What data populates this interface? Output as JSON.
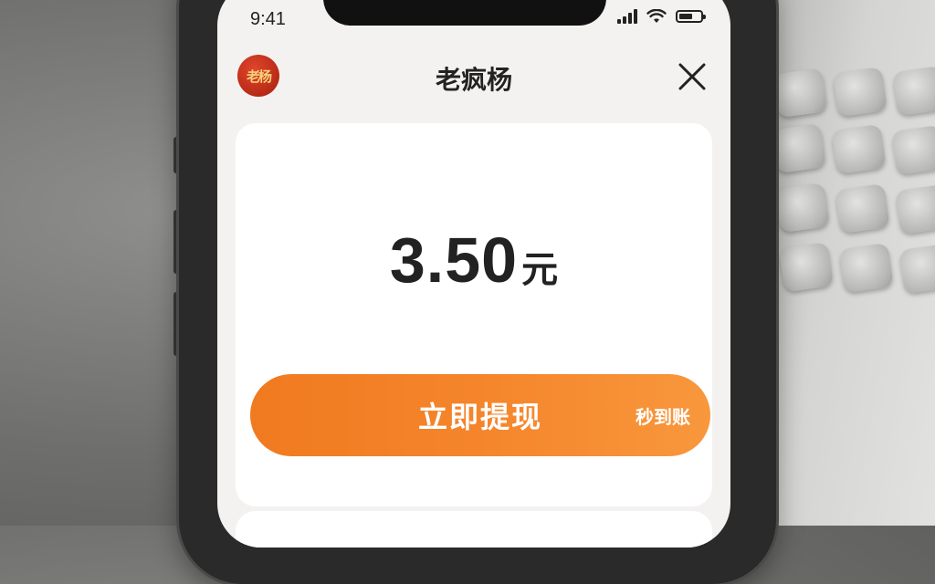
{
  "status_bar": {
    "time": "9:41"
  },
  "header": {
    "logo_text": "老杨",
    "title": "老疯杨",
    "close_icon": "close-icon"
  },
  "balance": {
    "amount": "3.50",
    "unit": "元"
  },
  "withdraw": {
    "button_label": "立即提现",
    "tag": "秒到账"
  },
  "colors": {
    "accent_orange": "#f5852b",
    "logo_red": "#c8321b",
    "screen_bg": "#f4f2f1"
  }
}
